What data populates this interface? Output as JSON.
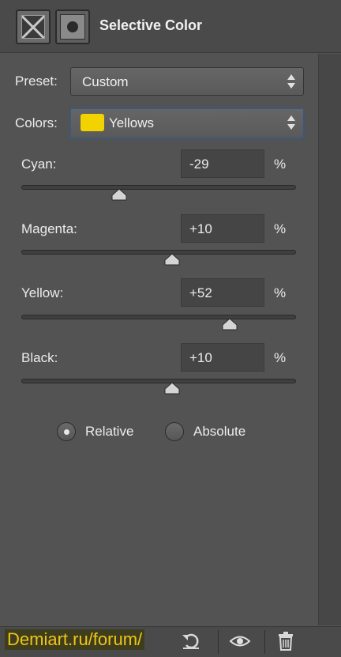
{
  "panel": {
    "title": "Selective Color",
    "header_icons": [
      "adjustment-layer-icon",
      "layer-mask-icon"
    ]
  },
  "preset": {
    "label": "Preset:",
    "value": "Custom"
  },
  "colors": {
    "label": "Colors:",
    "value": "Yellows",
    "swatch_color": "#f2d300"
  },
  "sliders": [
    {
      "label": "Cyan:",
      "value": "-29",
      "unit": "%",
      "level": -29
    },
    {
      "label": "Magenta:",
      "value": "+10",
      "unit": "%",
      "level": 10
    },
    {
      "label": "Yellow:",
      "value": "+52",
      "unit": "%",
      "level": 52
    },
    {
      "label": "Black:",
      "value": "+10",
      "unit": "%",
      "level": 10
    }
  ],
  "method": {
    "options": [
      {
        "label": "Relative",
        "selected": true
      },
      {
        "label": "Absolute",
        "selected": false
      }
    ]
  },
  "footer": {
    "watermark": "Demiart.ru/forum/",
    "icons": [
      "reset-icon",
      "visibility-eye-icon",
      "delete-trash-icon"
    ]
  }
}
